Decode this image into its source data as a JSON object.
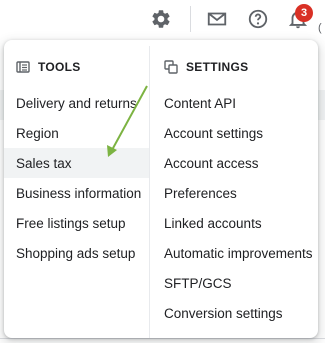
{
  "toolbar": {
    "icons": [
      "gear-icon",
      "mail-icon",
      "help-icon",
      "bell-icon"
    ],
    "notification_count": "3",
    "edge_glyph": "("
  },
  "menu": {
    "tools": {
      "header": "TOOLS",
      "header_icon": "tools-icon",
      "items": [
        "Delivery and returns",
        "Region",
        "Sales tax",
        "Business information",
        "Free listings setup",
        "Shopping ads setup"
      ],
      "selected_item": "Sales tax"
    },
    "settings": {
      "header": "SETTINGS",
      "header_icon": "settings-icon",
      "items": [
        "Content API",
        "Account settings",
        "Account access",
        "Preferences",
        "Linked accounts",
        "Automatic improvements",
        "SFTP/GCS",
        "Conversion settings"
      ]
    }
  },
  "annotation": {
    "arrow_color": "#7cb342"
  },
  "colors": {
    "badge": "#d93025",
    "hover_bg": "#f1f3f4"
  }
}
